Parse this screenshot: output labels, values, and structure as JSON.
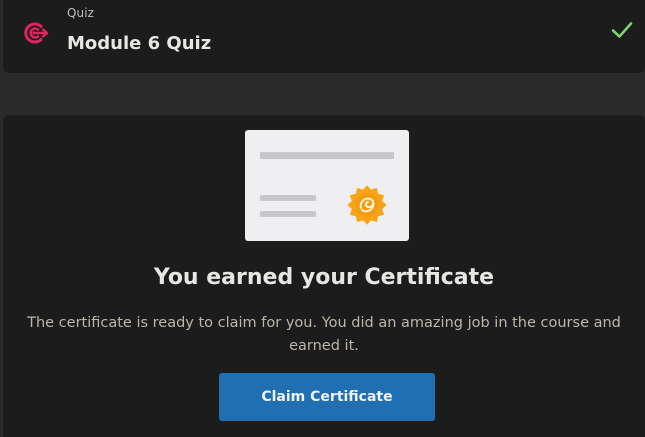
{
  "header": {
    "kicker": "Quiz",
    "title": "Module 6 Quiz",
    "icon": "target-icon",
    "status_icon": "check-icon"
  },
  "certificate": {
    "heading": "You earned your Certificate",
    "description": "The certificate is ready to claim for you. You did an amazing job in the course and earned it.",
    "button_label": "Claim Certificate"
  },
  "colors": {
    "accent_icon": "#e0245e",
    "check": "#7bd36b",
    "button": "#1f6fb2",
    "seal": "#f7a416"
  }
}
